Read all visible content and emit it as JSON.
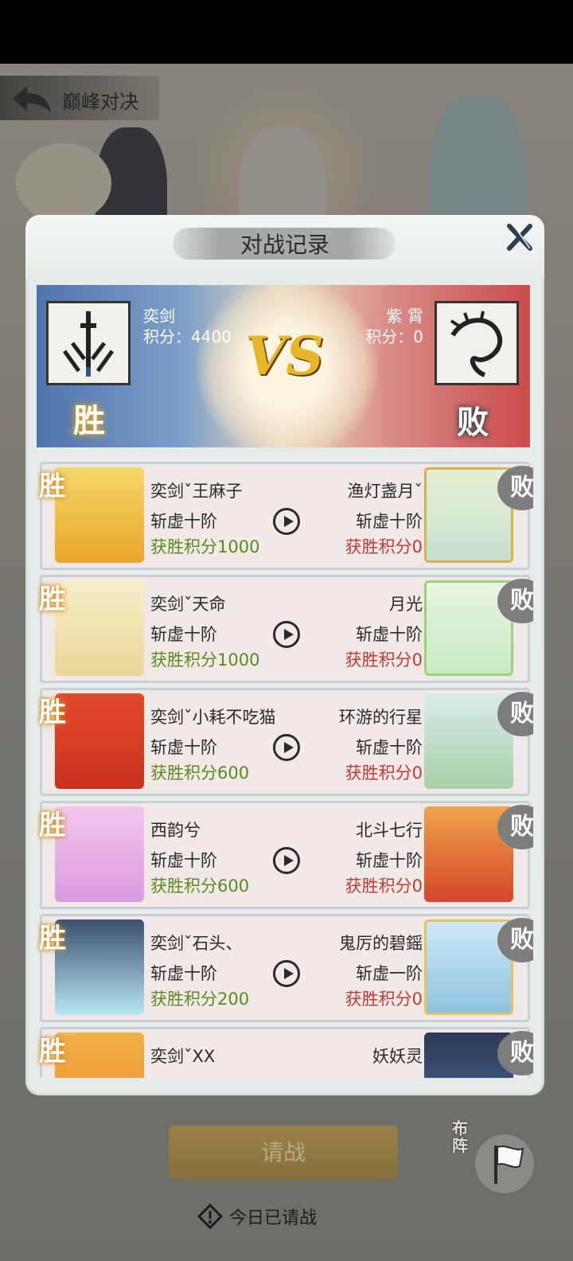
{
  "page": {
    "title": "巅峰对决"
  },
  "modal": {
    "title": "对战记录"
  },
  "summary": {
    "left": {
      "name": "奕剑",
      "score": "积分：4400",
      "result": "胜"
    },
    "center": "VS",
    "right": {
      "name": "紫 霄",
      "score": "积分：0",
      "result": "败"
    }
  },
  "matches": [
    {
      "win_badge": "胜",
      "lose_badge": "败",
      "left_name": "奕剑ˇ王麻子",
      "left_rank": "斩虚十阶",
      "left_points": "获胜积分1000",
      "right_name": "渔灯盏月ˇ",
      "right_rank": "斩虚十阶",
      "right_points": "获胜积分0"
    },
    {
      "win_badge": "胜",
      "lose_badge": "败",
      "left_name": "奕剑ˇ天命",
      "left_rank": "斩虚十阶",
      "left_points": "获胜积分1000",
      "right_name": "月光",
      "right_rank": "斩虚十阶",
      "right_points": "获胜积分0"
    },
    {
      "win_badge": "胜",
      "lose_badge": "败",
      "left_name": "奕剑ˇ小耗不吃猫",
      "left_rank": "斩虚十阶",
      "left_points": "获胜积分600",
      "right_name": "环游的行星",
      "right_rank": "斩虚十阶",
      "right_points": "获胜积分0"
    },
    {
      "win_badge": "胜",
      "lose_badge": "败",
      "left_name": "西韵兮",
      "left_rank": "斩虚十阶",
      "left_points": "获胜积分600",
      "right_name": "北斗七行",
      "right_rank": "斩虚十阶",
      "right_points": "获胜积分0"
    },
    {
      "win_badge": "胜",
      "lose_badge": "败",
      "left_name": "奕剑ˇ石头、",
      "left_rank": "斩虚十阶",
      "left_points": "获胜积分200",
      "right_name": "鬼厉的碧鎐",
      "right_rank": "斩虚一阶",
      "right_points": "获胜积分0"
    },
    {
      "win_badge": "胜",
      "lose_badge": "败",
      "left_name": "奕剑ˇXX",
      "left_rank": "",
      "left_points": "",
      "right_name": "妖妖灵",
      "right_rank": "",
      "right_points": ""
    }
  ],
  "buttons": {
    "challenge": "请战",
    "deploy": "布阵"
  },
  "notice": "今日已请战",
  "colors": {
    "win_text": "#5a8a1e",
    "lose_text": "#c23a32",
    "left_panel": "#4f74ad",
    "right_panel": "#c94c4c"
  }
}
